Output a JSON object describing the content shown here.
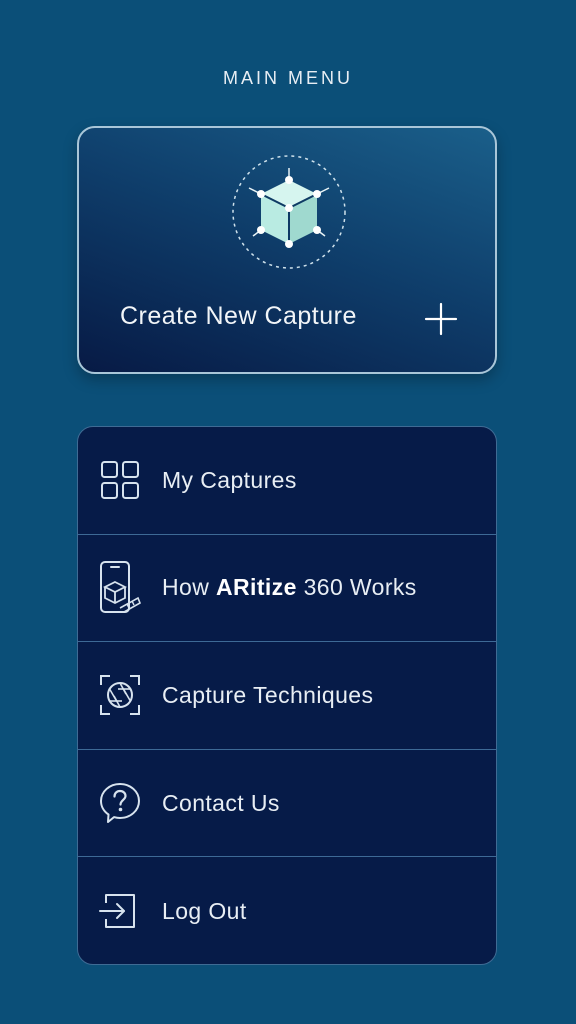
{
  "header": {
    "title": "MAIN MENU"
  },
  "create_card": {
    "label": "Create New Capture",
    "icon": "cube-icon",
    "action_icon": "plus-icon"
  },
  "menu": {
    "items": [
      {
        "label": "My Captures",
        "icon": "grid-icon"
      },
      {
        "label_prefix": "How ",
        "label_bold": "ARitize",
        "label_suffix": " 360 Works",
        "icon": "phone-cube-icon"
      },
      {
        "label": "Capture Techniques",
        "icon": "camera-aperture-icon"
      },
      {
        "label": "Contact Us",
        "icon": "help-bubble-icon"
      },
      {
        "label": "Log Out",
        "icon": "logout-icon"
      }
    ]
  },
  "colors": {
    "background": "#0b4f78",
    "menu_background": "#061b48",
    "accent": "#b9ebe2"
  }
}
